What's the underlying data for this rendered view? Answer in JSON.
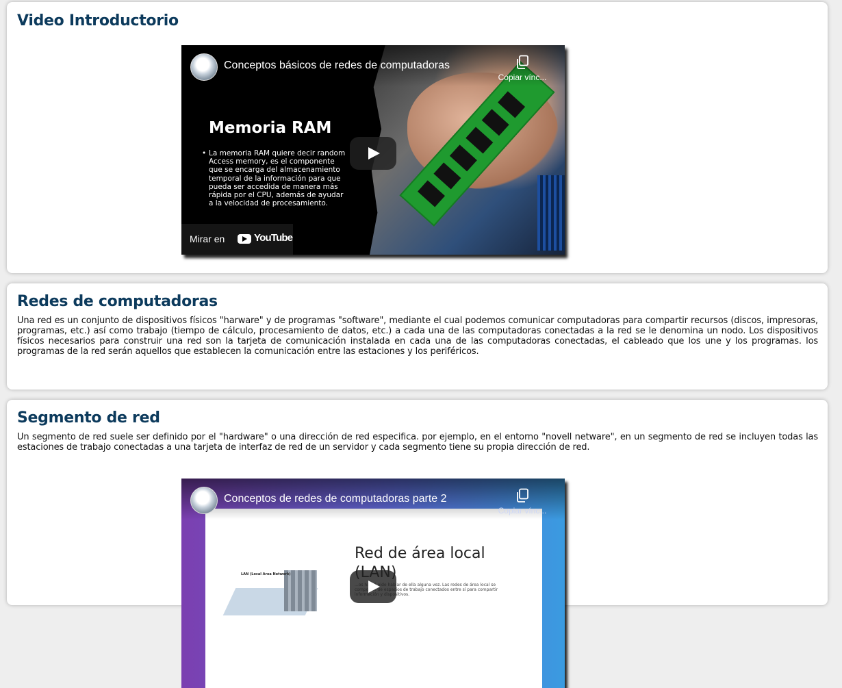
{
  "sections": [
    {
      "title": "Video Introductorio",
      "video": {
        "title": "Conceptos básicos de redes de computadoras",
        "copy_label": "Copiar vínc...",
        "watch_label": "Mirar en",
        "youtube_label": "YouTube",
        "thumbnail": {
          "heading": "Memoria RAM",
          "text": "La memoria RAM quiere decir random Access memory, es el componente que se encarga del almacenamiento temporal de la información para que pueda ser accedida de manera más rápida por el CPU, además de ayudar a la velocidad de procesamiento."
        }
      }
    },
    {
      "title": "Redes de computadoras",
      "body": "Una red es un conjunto de dispositivos físicos \"harware\" y de programas \"software\", mediante el cual podemos comunicar computadoras para compartir recursos (discos, impresoras, programas, etc.) así como trabajo (tiempo de cálculo, procesamiento de datos, etc.) a cada una de las computadoras conectadas a la red se le denomina un nodo. Los dispositivos físicos necesarios para construir una red son la tarjeta de comunicación instalada en cada una de las computadoras conectadas, el cableado que los une y los programas. los programas de la red serán aquellos que establecen la comunicación entre las estaciones y los periféricos."
    },
    {
      "title": "Segmento de red",
      "body": "Un segmento de red suele ser definido por el \"hardware\" o una dirección de red especifica. por ejemplo, en el entorno \"novell netware\", en un segmento de red se incluyen todas las estaciones de trabajo conectadas a una tarjeta de interfaz de red de un servidor y cada segmento tiene su propia dirección de red.",
      "video": {
        "title": "Conceptos de redes de computadoras parte 2",
        "copy_label": "Copiar vínc...",
        "thumbnail": {
          "heading": "Red de área local (LAN)",
          "lan_label": "LAN (Local Area Network)",
          "text": "...os habrá oído hablar de ella alguna vez. Las redes de área local se componen de espacios de trabajo conectados entre sí para compartir información y dispositivos."
        }
      }
    }
  ],
  "colors": {
    "heading": "#0c3a5c",
    "page_bg": "#eeeeee",
    "card_bg": "#ffffff"
  },
  "icons": [
    "copy-icon",
    "play-icon",
    "youtube-logo-icon",
    "channel-avatar-icon"
  ]
}
